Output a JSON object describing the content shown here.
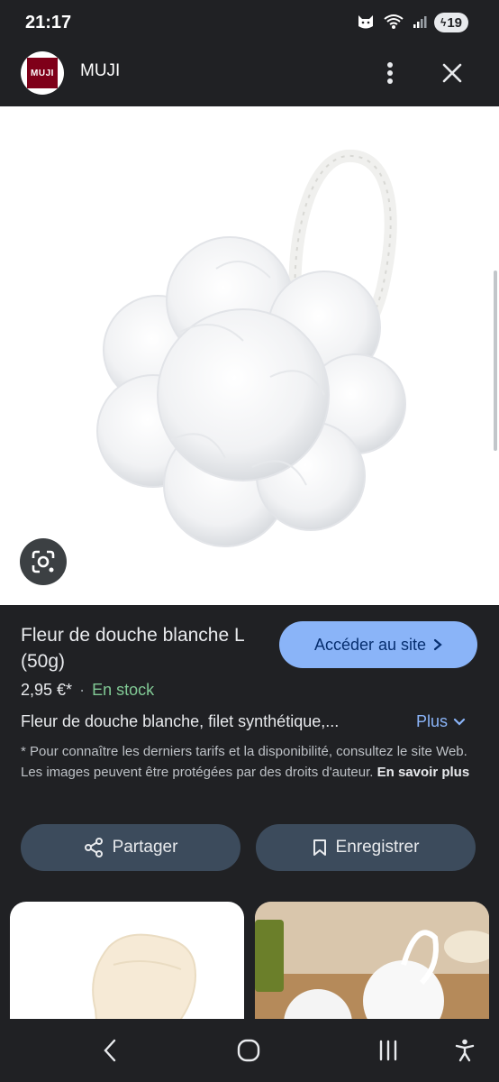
{
  "status_bar": {
    "time": "21:17",
    "battery": "19",
    "icons": [
      "cat-icon",
      "wifi-icon",
      "signal-icon"
    ]
  },
  "header": {
    "logo_text": "MUJI",
    "site_name": "MUJI",
    "more_icon": "more-vert-icon",
    "close_icon": "close-icon"
  },
  "product": {
    "title": "Fleur de douche blanche L (50g)",
    "visit_button": "Accéder au site",
    "price": "2,95 €*",
    "separator": "·",
    "stock": "En stock",
    "description": "Fleur de douche blanche, filet synthétique,...",
    "more_label": "Plus",
    "disclaimer": "* Pour connaître les derniers tarifs et la disponibilité, consultez le site Web. Les images peuvent être protégées par des droits d'auteur.",
    "learn_more": "En savoir plus"
  },
  "actions": {
    "share": "Partager",
    "save": "Enregistrer"
  },
  "colors": {
    "background": "#202124",
    "accent": "#8ab4f8",
    "stock": "#81c995",
    "action_button": "#3c4b5c",
    "logo": "#7f0019"
  }
}
